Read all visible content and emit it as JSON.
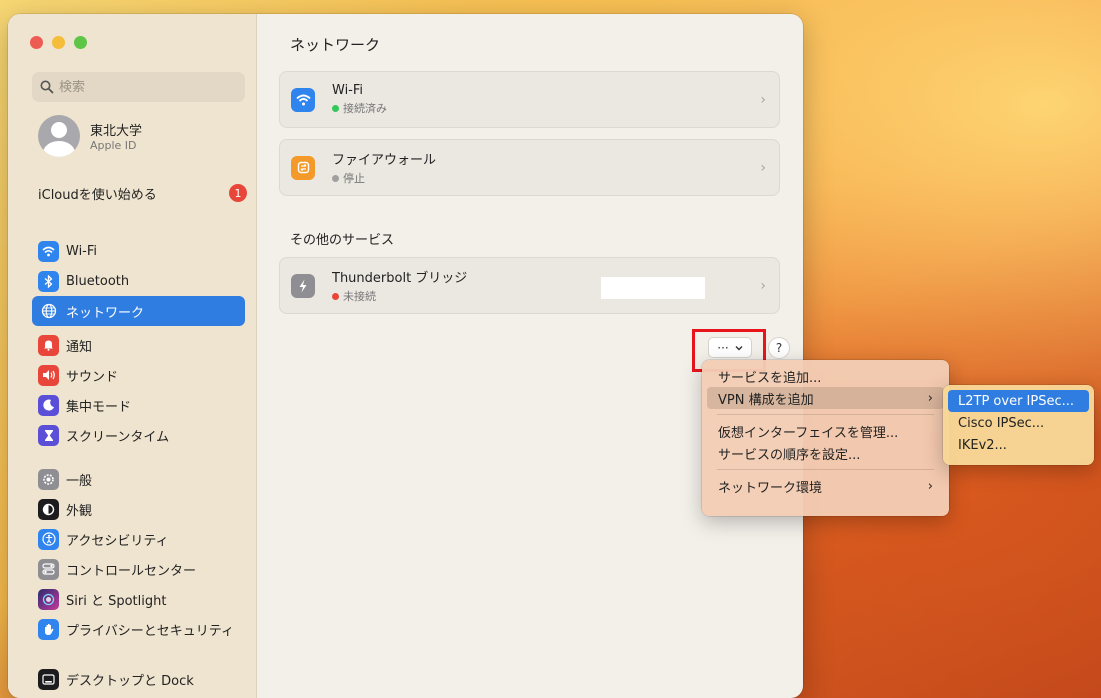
{
  "sidebar": {
    "search_placeholder": "検索",
    "account": {
      "name": "東北大学",
      "sub": "Apple ID"
    },
    "icloud": {
      "label": "iCloudを使い始める",
      "badge": "1"
    },
    "items": [
      {
        "label": "Wi-Fi",
        "icon": "wifi-icon",
        "color": "#2f84ee"
      },
      {
        "label": "Bluetooth",
        "icon": "bluetooth-icon",
        "color": "#2f84ee"
      },
      {
        "label": "ネットワーク",
        "icon": "globe-icon",
        "color": "#2f84ee",
        "selected": true
      },
      {
        "label": "通知",
        "icon": "bell-icon",
        "color": "#e8463a"
      },
      {
        "label": "サウンド",
        "icon": "speaker-icon",
        "color": "#e8463a"
      },
      {
        "label": "集中モード",
        "icon": "moon-icon",
        "color": "#5a4fd6"
      },
      {
        "label": "スクリーンタイム",
        "icon": "hourglass-icon",
        "color": "#5a4fd6"
      },
      {
        "label": "一般",
        "icon": "gear-icon",
        "color": "#8e8e93"
      },
      {
        "label": "外観",
        "icon": "appearance-icon",
        "color": "#1c1c1e"
      },
      {
        "label": "アクセシビリティ",
        "icon": "accessibility-icon",
        "color": "#2f84ee"
      },
      {
        "label": "コントロールセンター",
        "icon": "control-center-icon",
        "color": "#8e8e93"
      },
      {
        "label": "Siri と Spotlight",
        "icon": "siri-icon",
        "color": "#6a3fd0"
      },
      {
        "label": "プライバシーとセキュリティ",
        "icon": "hand-icon",
        "color": "#2f84ee"
      },
      {
        "label": "デスクトップと Dock",
        "icon": "dock-icon",
        "color": "#1c1c1e"
      }
    ]
  },
  "main": {
    "title": "ネットワーク",
    "services": [
      {
        "name": "Wi-Fi",
        "status": "接続済み",
        "status_color": "#34c759",
        "icon": "wifi-icon",
        "color": "#2f84ee"
      },
      {
        "name": "ファイアウォール",
        "status": "停止",
        "status_color": "#a0a0a0",
        "icon": "firewall-icon",
        "color": "#f39a2b"
      }
    ],
    "other_title": "その他のサービス",
    "other": [
      {
        "name": "Thunderbolt ブリッジ",
        "status": "未接続",
        "status_color": "#e8463a",
        "icon": "thunderbolt-icon",
        "color": "#8e8e93"
      }
    ],
    "more_label": "···",
    "help_label": "?"
  },
  "menu": {
    "items": [
      "サービスを追加...",
      "VPN 構成を追加",
      "仮想インターフェイスを管理...",
      "サービスの順序を設定...",
      "ネットワーク環境"
    ],
    "submenu": [
      "L2TP over IPSec...",
      "Cisco IPSec...",
      "IKEv2..."
    ]
  }
}
